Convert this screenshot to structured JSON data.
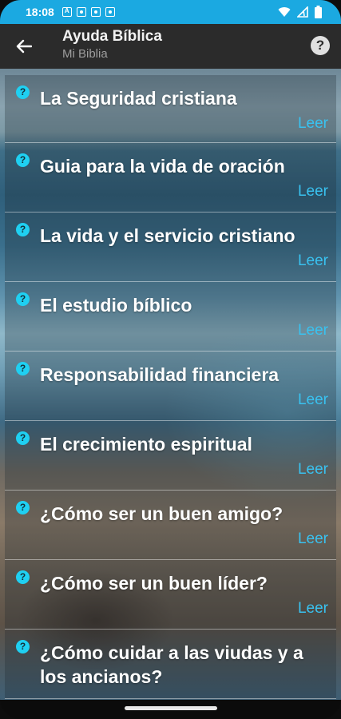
{
  "status_bar": {
    "time": "18:08",
    "icons_left": [
      "notification-icon-a",
      "notification-icon-b",
      "notification-icon-c",
      "notification-icon-d"
    ],
    "icons_right": [
      "wifi-icon",
      "signal-icon",
      "battery-icon"
    ],
    "background_color": "#1ba9e1"
  },
  "app_bar": {
    "title": "Ayuda Bíblica",
    "subtitle": "Mi Biblia",
    "back_icon": "arrow-left-icon",
    "help_icon": "help-icon",
    "help_glyph": "?"
  },
  "list": {
    "items": [
      {
        "title": "La Seguridad cristiana",
        "action": "Leer"
      },
      {
        "title": "Guia para la vida de oración",
        "action": "Leer"
      },
      {
        "title": "La vida y el servicio cristiano",
        "action": "Leer"
      },
      {
        "title": "El estudio bíblico",
        "action": "Leer"
      },
      {
        "title": "Responsabilidad financiera",
        "action": "Leer"
      },
      {
        "title": "El crecimiento espiritual",
        "action": "Leer"
      },
      {
        "title": "¿Cómo ser un buen amigo?",
        "action": "Leer"
      },
      {
        "title": "¿Cómo ser un buen líder?",
        "action": "Leer"
      },
      {
        "title": "¿Cómo cuidar a las viudas y a los ancianos?",
        "action": ""
      }
    ],
    "item_icon": "question-mark-icon",
    "item_icon_glyph": "?",
    "accent_color": "#39c2f0"
  }
}
